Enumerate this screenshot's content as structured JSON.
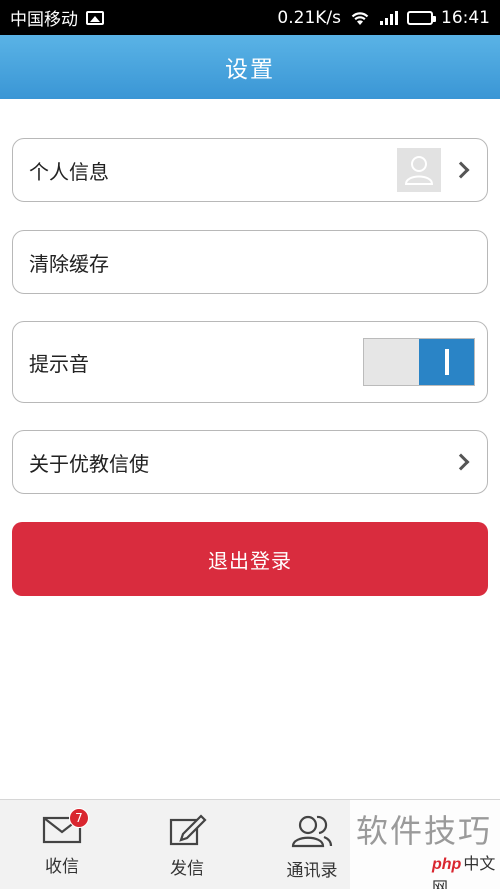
{
  "status_bar": {
    "carrier": "中国移动",
    "speed": "0.21K/s",
    "time": "16:41"
  },
  "header": {
    "title": "设置"
  },
  "settings": {
    "personal_info": "个人信息",
    "clear_cache": "清除缓存",
    "notification_sound": "提示音",
    "notification_sound_on": 1,
    "about": "关于优教信使"
  },
  "logout_label": "退出登录",
  "tab_bar": {
    "inbox": {
      "label": "收信",
      "badge": "7"
    },
    "compose": {
      "label": "发信"
    },
    "contacts": {
      "label": "通讯录"
    }
  },
  "watermark": {
    "text": "软件技巧",
    "site": "中文网",
    "logo": "php"
  },
  "colors": {
    "header": "#3a96d5",
    "logout": "#d92c3e",
    "toggle_on": "#2a84c6",
    "badge": "#d9262f"
  }
}
